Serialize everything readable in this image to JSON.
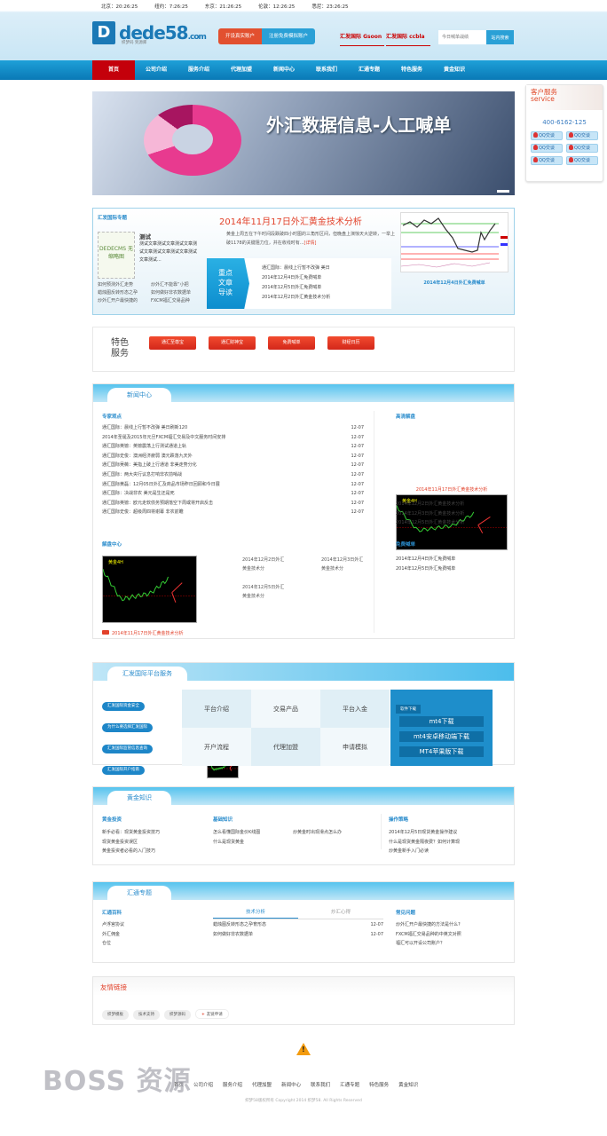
{
  "times": [
    "北京：20:26:25",
    "纽约：7:26:25",
    "东京：21:26:25",
    "伦敦：12:26:25",
    "悉尼：23:26:25"
  ],
  "logo": {
    "name": "dede58",
    "tld": ".com",
    "slogan": "织梦码 到源库"
  },
  "header": {
    "open_real": "开设真实账户",
    "open_demo": "注册免费模拟账户",
    "brands": [
      "汇发国际 Gsoon",
      "汇发国际 ccbla"
    ],
    "search_placeholder": "今日喊单战绩",
    "search_button": "站内搜索"
  },
  "nav": [
    "首页",
    "公司介绍",
    "服务介绍",
    "代理加盟",
    "新闻中心",
    "联系我们",
    "汇通专题",
    "特色服务",
    "黄金知识"
  ],
  "banner": {
    "title": "外汇数据信息-人工喊单"
  },
  "service": {
    "title": "客户服务",
    "subtitle": "service",
    "phone": "400-6162-125",
    "qq": [
      "QQ交谈",
      "QQ交谈",
      "QQ交谈",
      "QQ交谈",
      "QQ交谈",
      "QQ交谈"
    ]
  },
  "feature": {
    "tag": "汇发国际专题",
    "placeholder": "DEDECMS 无缩略图",
    "item_title": "测试",
    "item_desc": "测试文章测试文章测试文章测试文章测试文章测试文章测试文章测试...",
    "links": [
      "如何预测外汇走势",
      "炒外汇不能靠“小把",
      "蜡烛图反转形态之孕",
      "如何做好非农数据单",
      "炒外汇开户最快捷的",
      "FXCM福汇交易品种"
    ],
    "headline": "2014年11月17日外汇黄金技术分析",
    "desc": "黄金上周五在下午时间段跌破四小时图的三角形区间，但晚盘上演惊天大逆转，一举上破1178的关键阻力位，并在收线时有...",
    "more": "[详情]",
    "key_label": "重点文章导读",
    "key_items": [
      "通汇国际：晨线上行暂不改弹 美日",
      "2014年12月4日外汇免费喊单",
      "2014年12月5日外汇免费喊单",
      "2014年12月2日外汇黄金技术分析"
    ],
    "chart_caption": "2014年12月4日外汇免费喊单"
  },
  "special": {
    "label": "特色服务",
    "buttons": [
      "通汇至尊宝",
      "通汇财神宝",
      "免费喊单",
      "财经日历"
    ]
  },
  "news": {
    "title": "新闻中心",
    "expert_title": "专家观点",
    "expert": [
      [
        "通汇国际：晨线上行暂不改弹 美日刷新120",
        "12-07"
      ],
      [
        "2014年圣诞及2015年元旦FXCM福汇交易及中文服务时间安排",
        "12-07"
      ],
      [
        "通汇国际英镑：英镑震荡上行测试通道上轨",
        "12-07"
      ],
      [
        "通汇国际史俊：澳洲经济疲弱 澳元跌落九天外",
        "12-07"
      ],
      [
        "通汇国际吴薇：美指上破上行通道 非美走势分化",
        "12-07"
      ],
      [
        "通汇国际：两大央行议息打响非农前哨战",
        "12-07"
      ],
      [
        "通汇国际黄磊：12月05日外汇及商品市场昨日回顾和今日展",
        "12-07"
      ],
      [
        "通汇国际：决战非农 美元是生还是死",
        "12-07"
      ],
      [
        "通汇国际英镑：欧元走软债务预期落空下周或将开启反击",
        "12-07"
      ],
      [
        "通汇国际史俊：超级周四将谢幕 非农前瞻",
        "12-07"
      ]
    ],
    "analysis_title": "解盘中心",
    "analysis_main": "2014年11月17日外汇黄金技术分析",
    "analysis_thumbs": [
      "2014年12月2日外汇黄金技术分",
      "2014年12月3日外汇黄金技术分",
      "2014年12月5日外汇黄金技术分"
    ],
    "hd_title": "高清解盘",
    "hd_caption": "2014年11月17日外汇黄金技术分析",
    "hd_list": [
      "2014年12月2日外汇黄金技术分析",
      "2014年12月3日外汇黄金技术分析",
      "2014年12月5日外汇黄金技术分析"
    ],
    "free_title": "免费喊单",
    "free_list": [
      "2014年12月4日外汇免费喊单",
      "2014年12月5日外汇免费喊单"
    ],
    "chart_label": "黄金4H"
  },
  "platform": {
    "title": "汇发国际平台服务",
    "pills": [
      "汇发国际资金安全",
      "为什么要选择汇发国际",
      "汇发国际监管信息查询",
      "汇发国际开户指南",
      "汇发国际公司简介与荣誉"
    ],
    "grid": [
      "平台介绍",
      "交易产品",
      "平台入金",
      "开户流程",
      "代理加盟",
      "申请模拟"
    ],
    "download_tag": "软件下载",
    "downloads": [
      "mt4下载",
      "mt4安卓移动端下载",
      "MT4苹果版下载"
    ]
  },
  "gold": {
    "title": "黄金知识",
    "cols": [
      {
        "title": "黄金投资",
        "items": [
          "新手必看：现货黄金投资技巧",
          "现货黄金投资误区",
          "黄金投资者必看的入门技巧"
        ]
      },
      {
        "title": "基础知识",
        "items": [
          "怎么看懂国际金价K线图",
          "什么是现货黄金"
        ]
      },
      {
        "title": "",
        "items": [
          "炒黄金时出现滑点怎么办"
        ]
      },
      {
        "title": "操作策略",
        "items": [
          "2014年12月5日现货黄金操作建议",
          "什么是现货黄金隔夜费？如何计算现",
          "炒黄金新手入门必读"
        ]
      }
    ]
  },
  "huitong": {
    "title": "汇通专题",
    "baike_title": "汇通百科",
    "baike": [
      "卢浮宫协议",
      "外汇佣金",
      "仓位"
    ],
    "tabs": [
      "技术分析",
      "炒汇心得"
    ],
    "tab_items": [
      [
        "蜡烛图反转形态之孕育形态",
        "12-07"
      ],
      [
        "如何做好非农数据单",
        "12-07"
      ]
    ],
    "faq_title": "常见问题",
    "faq": [
      "炒外汇开户最快捷的方法是什么?",
      "FXCM福汇交易品种的中英文对照",
      "福汇可以开设公司账户？"
    ]
  },
  "links": {
    "title": "友情链接",
    "items": [
      "织梦模板",
      "技术支持",
      "织梦源码"
    ],
    "apply": "友链申请"
  },
  "footer": {
    "nav": [
      "首页",
      "公司介绍",
      "服务介绍",
      "代理加盟",
      "新闻中心",
      "联系我们",
      "汇通专题",
      "特色服务",
      "黄金知识"
    ],
    "copyright": "织梦58版权所有 Copyright 2014 织梦58. All Rights Reserved"
  },
  "watermark": "BOSS 资源",
  "colors": {
    "nav_blue": "#0a79b6",
    "nav_active": "#c4000b",
    "accent_red": "#e2412a",
    "link_blue": "#2a8ccc"
  }
}
